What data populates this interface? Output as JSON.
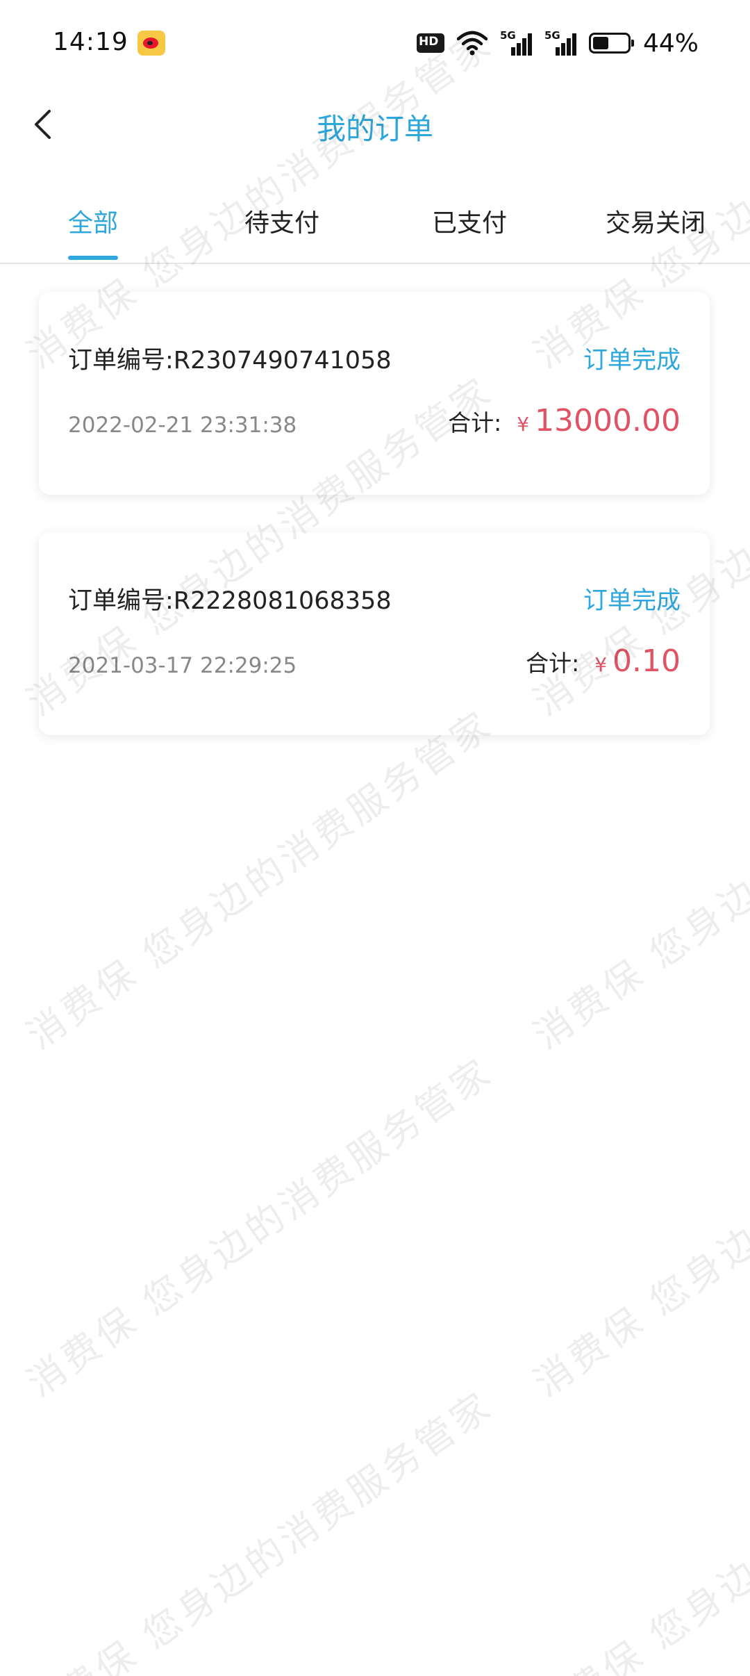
{
  "status_bar": {
    "time": "14:19",
    "battery": "44%",
    "network_1": "5G",
    "network_2": "5G"
  },
  "header": {
    "title": "我的订单"
  },
  "tabs": [
    {
      "label": "全部",
      "active": true
    },
    {
      "label": "待支付",
      "active": false
    },
    {
      "label": "已支付",
      "active": false
    },
    {
      "label": "交易关闭",
      "active": false
    }
  ],
  "orders": [
    {
      "number_label": "订单编号:R2307490741058",
      "status": "订单完成",
      "date": "2022-02-21 23:31:38",
      "total_label": "合计:",
      "currency": "¥",
      "amount": "13000.00"
    },
    {
      "number_label": "订单编号:R2228081068358",
      "status": "订单完成",
      "date": "2021-03-17 22:29:25",
      "total_label": "合计:",
      "currency": "¥",
      "amount": "0.10"
    }
  ],
  "watermark": {
    "text": "消费保 您身边的消费服务管家"
  },
  "colors": {
    "accent": "#2ea7dc",
    "price": "#e05264",
    "secondary_text": "#888888"
  }
}
